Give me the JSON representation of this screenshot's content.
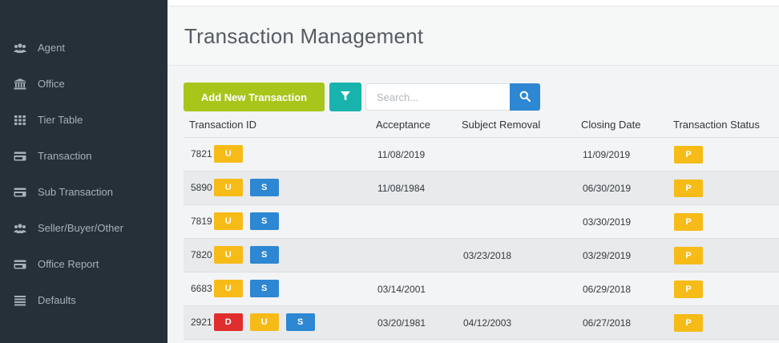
{
  "sidebar": {
    "items": [
      {
        "label": "Agent",
        "icon": "users-icon"
      },
      {
        "label": "Office",
        "icon": "bank-icon"
      },
      {
        "label": "Tier Table",
        "icon": "grid-icon"
      },
      {
        "label": "Transaction",
        "icon": "credit-card-icon"
      },
      {
        "label": "Sub Transaction",
        "icon": "credit-card-icon"
      },
      {
        "label": "Seller/Buyer/Other",
        "icon": "users-icon"
      },
      {
        "label": "Office Report",
        "icon": "credit-card-icon"
      },
      {
        "label": "Defaults",
        "icon": "list-icon"
      }
    ]
  },
  "header": {
    "title": "Transaction Management"
  },
  "toolbar": {
    "add_label": "Add New Transaction",
    "filter_icon": "filter-icon",
    "search_placeholder": "Search...",
    "search_value": "",
    "search_icon": "search-icon"
  },
  "table": {
    "columns": [
      "Transaction ID",
      "Acceptance",
      "Subject Removal",
      "Closing Date",
      "Transaction Status"
    ],
    "rows": [
      {
        "id": "7821",
        "badges": [
          "U"
        ],
        "acceptance": "11/08/2019",
        "subject_removal": "",
        "closing_date": "11/09/2019",
        "status": "P"
      },
      {
        "id": "5890",
        "badges": [
          "U",
          "S"
        ],
        "acceptance": "11/08/1984",
        "subject_removal": "",
        "closing_date": "06/30/2019",
        "status": "P"
      },
      {
        "id": "7819",
        "badges": [
          "U",
          "S"
        ],
        "acceptance": "",
        "subject_removal": "",
        "closing_date": "03/30/2019",
        "status": "P"
      },
      {
        "id": "7820",
        "badges": [
          "U",
          "S"
        ],
        "acceptance": "",
        "subject_removal": "03/23/2018",
        "closing_date": "03/29/2019",
        "status": "P"
      },
      {
        "id": "6683",
        "badges": [
          "U",
          "S"
        ],
        "acceptance": "03/14/2001",
        "subject_removal": "",
        "closing_date": "06/29/2018",
        "status": "P"
      },
      {
        "id": "2921",
        "badges": [
          "D",
          "U",
          "S"
        ],
        "acceptance": "03/20/1981",
        "subject_removal": "04/12/2003",
        "closing_date": "06/27/2018",
        "status": "P"
      }
    ]
  },
  "colors": {
    "sidebar_bg": "#253039",
    "add_button": "#a8c51b",
    "filter_button": "#19b3ad",
    "search_button": "#2d87d2",
    "badge_u": "#f6bb17",
    "badge_s": "#2d87d2",
    "badge_d": "#e02d2d",
    "badge_p": "#f6bb17"
  }
}
